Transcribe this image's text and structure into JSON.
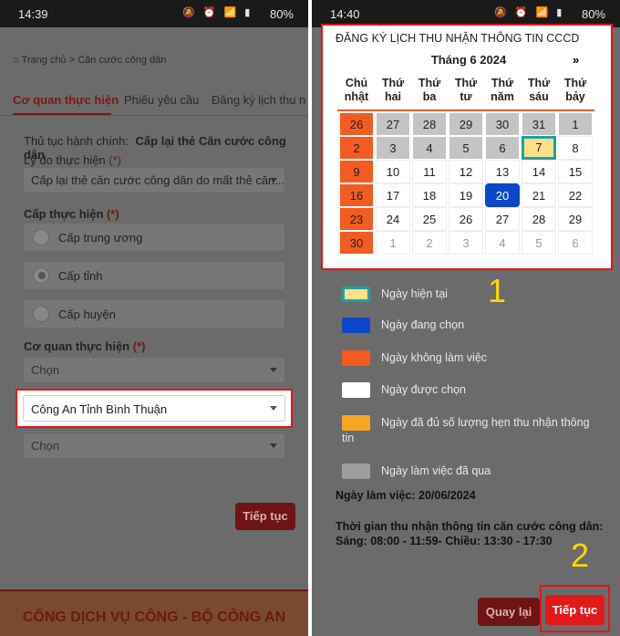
{
  "left": {
    "status": {
      "time": "14:39",
      "icons": "🔕 ⏰ 📶 ▮",
      "battery": "80%"
    },
    "breadcrumb": {
      "home": "Trang chủ",
      "sep": ">",
      "current": "Căn cước công dân"
    },
    "tabs": [
      "Cơ quan thực hiện",
      "Phiếu yêu cầu",
      "Đăng ký lịch thu n"
    ],
    "procedure_label": "Thủ tục hành chính:",
    "procedure_value": "Cấp lại thẻ Căn cước công dân",
    "reason_label": "Lý do thực hiện",
    "required_mark": "(*)",
    "reason_value": "Cấp lại thẻ căn cước công dân do mất thẻ căn...",
    "level_label": "Cấp thực hiện",
    "levels": [
      "Cấp trung ương",
      "Cấp tỉnh",
      "Cấp huyện"
    ],
    "agency_label": "Cơ quan thực hiện",
    "select1": "Chọn",
    "select_highlight": "Công An Tỉnh Bình Thuận",
    "select2": "Chọn",
    "continue": "Tiếp tục",
    "footer": "CỔNG DỊCH VỤ CÔNG - BỘ CÔNG AN"
  },
  "right": {
    "status": {
      "time": "14:40",
      "icons": "🔕 ⏰ 📶 ▮",
      "battery": "80%"
    },
    "calendar": {
      "heading": "ĐĂNG KÝ LỊCH THU NHẬN THÔNG TIN CCCD",
      "month": "Tháng 6 2024",
      "next": "»",
      "weekdays": [
        [
          "Chủ",
          "nhật"
        ],
        [
          "Thứ",
          "hai"
        ],
        [
          "Thứ",
          "ba"
        ],
        [
          "Thứ",
          "tư"
        ],
        [
          "Thứ",
          "năm"
        ],
        [
          "Thứ",
          "sáu"
        ],
        [
          "Thứ",
          "bảy"
        ]
      ],
      "days": [
        [
          "26",
          "27",
          "28",
          "29",
          "30",
          "31",
          "1"
        ],
        [
          "2",
          "3",
          "4",
          "5",
          "6",
          "7",
          "8"
        ],
        [
          "9",
          "10",
          "11",
          "12",
          "13",
          "14",
          "15"
        ],
        [
          "16",
          "17",
          "18",
          "19",
          "20",
          "21",
          "22"
        ],
        [
          "23",
          "24",
          "25",
          "26",
          "27",
          "28",
          "29"
        ],
        [
          "30",
          "1",
          "2",
          "3",
          "4",
          "5",
          "6"
        ]
      ],
      "today": "7",
      "selected": "20"
    },
    "legend": [
      {
        "label": "Ngày hiện tại",
        "color": "#ffe08a",
        "border": "#1aa3a3"
      },
      {
        "label": "Ngày đang chọn",
        "color": "#0d47c9",
        "border": "none"
      },
      {
        "label": "Ngày không làm việc",
        "color": "#f25c22",
        "border": "none"
      },
      {
        "label": "Ngày được chọn",
        "color": "#ffffff",
        "border": "none"
      },
      {
        "label": "Ngày đã đủ số lượng hẹn thu nhận thông",
        "label2": "tin",
        "color": "#f5a623",
        "border": "none"
      },
      {
        "label": "Ngày làm việc đã qua",
        "color": "#9e9e9e",
        "border": "none"
      }
    ],
    "workday": "Ngày làm việc: 20/06/2024",
    "time_title": "Thời gian thu nhận thông tin căn cước công dân:",
    "time_value": "Sáng: 08:00 - 11:59- Chiều: 13:30 - 17:30",
    "back": "Quay lại",
    "continue": "Tiếp tục"
  },
  "annotations": {
    "one": "1",
    "two": "2"
  }
}
